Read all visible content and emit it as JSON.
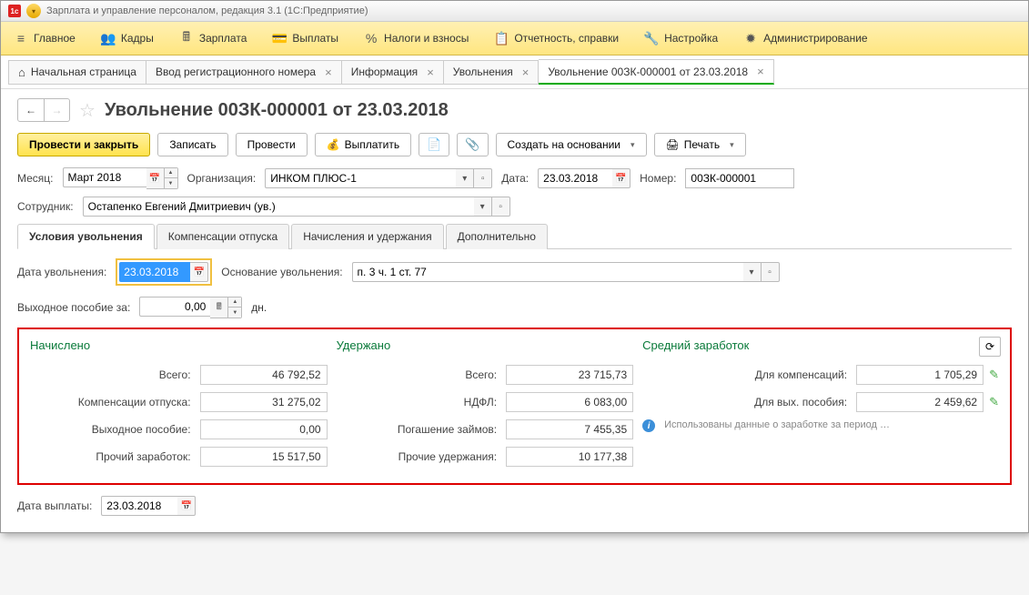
{
  "app_title": "Зарплата и управление персоналом, редакция 3.1  (1С:Предприятие)",
  "mainmenu": [
    {
      "label": "Главное",
      "icon": "≡"
    },
    {
      "label": "Кадры",
      "icon": "👥"
    },
    {
      "label": "Зарплата",
      "icon": "🖩"
    },
    {
      "label": "Выплаты",
      "icon": "💳"
    },
    {
      "label": "Налоги и взносы",
      "icon": "%"
    },
    {
      "label": "Отчетность, справки",
      "icon": "📋"
    },
    {
      "label": "Настройка",
      "icon": "🔧"
    },
    {
      "label": "Администрирование",
      "icon": "✹"
    }
  ],
  "tabs": [
    {
      "label": "Начальная страница",
      "home": true,
      "closable": false
    },
    {
      "label": "Ввод регистрационного номера",
      "closable": true
    },
    {
      "label": "Информация",
      "closable": true
    },
    {
      "label": "Увольнения",
      "closable": true
    },
    {
      "label": "Увольнение 00ЗК-000001 от 23.03.2018",
      "closable": true,
      "active": true
    }
  ],
  "page_title": "Увольнение 00ЗК-000001 от 23.03.2018",
  "toolbar": {
    "conduct_close": "Провести и закрыть",
    "write": "Записать",
    "conduct": "Провести",
    "pay": "Выплатить",
    "create_based": "Создать на основании",
    "print": "Печать"
  },
  "form": {
    "month_label": "Месяц:",
    "month_value": "Март 2018",
    "org_label": "Организация:",
    "org_value": "ИНКОМ ПЛЮС-1",
    "date_label": "Дата:",
    "date_value": "23.03.2018",
    "number_label": "Номер:",
    "number_value": "00ЗК-000001",
    "employee_label": "Сотрудник:",
    "employee_value": "Остапенко Евгений Дмитриевич (ув.)"
  },
  "subtabs": [
    "Условия увольнения",
    "Компенсации отпуска",
    "Начисления и удержания",
    "Дополнительно"
  ],
  "dismissal": {
    "date_label": "Дата увольнения:",
    "date_value": "23.03.2018",
    "basis_label": "Основание увольнения:",
    "basis_value": "п. 3 ч. 1 ст. 77",
    "severance_label": "Выходное пособие за:",
    "severance_value": "0,00",
    "severance_unit": "дн."
  },
  "summary": {
    "accrued_title": "Начислено",
    "withheld_title": "Удержано",
    "avgearn_title": "Средний заработок",
    "accrued": {
      "total_label": "Всего:",
      "total_value": "46 792,52",
      "comp_label": "Компенсации отпуска:",
      "comp_value": "31 275,02",
      "sev_label": "Выходное пособие:",
      "sev_value": "0,00",
      "other_label": "Прочий заработок:",
      "other_value": "15 517,50"
    },
    "withheld": {
      "total_label": "Всего:",
      "total_value": "23 715,73",
      "ndfl_label": "НДФЛ:",
      "ndfl_value": "6 083,00",
      "loans_label": "Погашение займов:",
      "loans_value": "7 455,35",
      "other_label": "Прочие удержания:",
      "other_value": "10 177,38"
    },
    "avg": {
      "comp_label": "Для компенсаций:",
      "comp_value": "1 705,29",
      "sev_label": "Для вых. пособия:",
      "sev_value": "2 459,62",
      "info_text": "Использованы данные о заработке за период …"
    }
  },
  "payment": {
    "date_label": "Дата выплаты:",
    "date_value": "23.03.2018"
  }
}
